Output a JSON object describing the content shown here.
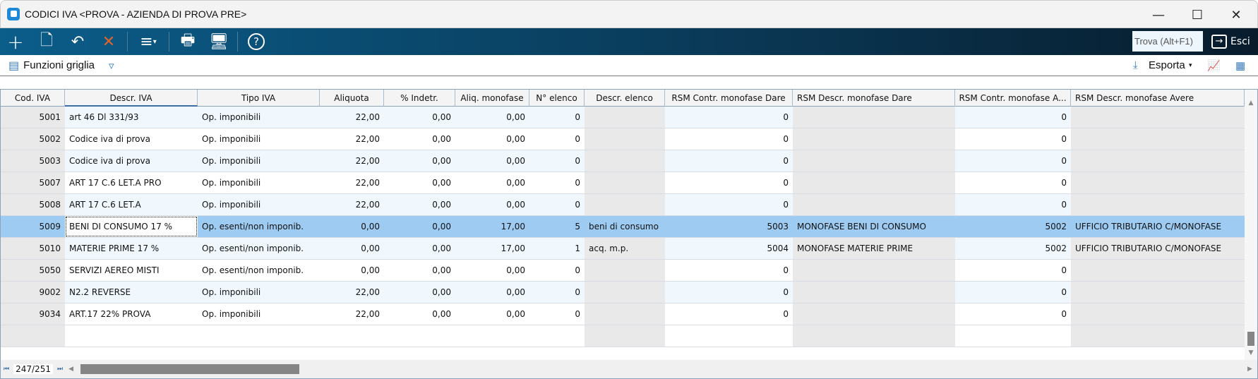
{
  "window": {
    "title": "CODICI IVA <PROVA - AZIENDA DI PROVA PRE>",
    "minimize": "—",
    "maximize": "☐",
    "close": "✕"
  },
  "toolbar": {
    "find_placeholder": "Trova (Alt+F1)",
    "exit_label": "Esci"
  },
  "subbar": {
    "grid_functions": "Funzioni griglia",
    "export": "Esporta"
  },
  "columns": [
    "Cod. IVA",
    "Descr. IVA",
    "Tipo IVA",
    "Aliquota",
    "% Indetr.",
    "Aliq. monofase",
    "N° elenco",
    "Descr. elenco",
    "RSM Contr. monofase Dare",
    "RSM Descr. monofase Dare",
    "RSM Contr. monofase A...",
    "RSM Descr. monofase Avere"
  ],
  "rows": [
    [
      "5001",
      "art 46 Dl 331/93",
      "Op. imponibili",
      "22,00",
      "0,00",
      "0,00",
      "0",
      "",
      "0",
      "",
      "0",
      ""
    ],
    [
      "5002",
      "Codice iva di prova",
      "Op. imponibili",
      "22,00",
      "0,00",
      "0,00",
      "0",
      "",
      "0",
      "",
      "0",
      ""
    ],
    [
      "5003",
      "Codice iva di prova",
      "Op. imponibili",
      "22,00",
      "0,00",
      "0,00",
      "0",
      "",
      "0",
      "",
      "0",
      ""
    ],
    [
      "5007",
      "ART 17 C.6 LET.A PRO",
      "Op. imponibili",
      "22,00",
      "0,00",
      "0,00",
      "0",
      "",
      "0",
      "",
      "0",
      ""
    ],
    [
      "5008",
      "ART 17 C.6 LET.A",
      "Op. imponibili",
      "22,00",
      "0,00",
      "0,00",
      "0",
      "",
      "0",
      "",
      "0",
      ""
    ],
    [
      "5009",
      "BENI DI CONSUMO 17 %",
      "Op. esenti/non imponib.",
      "0,00",
      "0,00",
      "17,00",
      "5",
      "beni di consumo",
      "5003",
      "MONOFASE BENI DI CONSUMO",
      "5002",
      "UFFICIO TRIBUTARIO C/MONOFASE"
    ],
    [
      "5010",
      "MATERIE PRIME 17 %",
      "Op. esenti/non imponib.",
      "0,00",
      "0,00",
      "17,00",
      "1",
      "acq. m.p.",
      "5004",
      "MONOFASE MATERIE PRIME",
      "5002",
      "UFFICIO TRIBUTARIO C/MONOFASE"
    ],
    [
      "5050",
      "SERVIZI AEREO MISTI",
      "Op. esenti/non imponib.",
      "0,00",
      "0,00",
      "0,00",
      "0",
      "",
      "0",
      "",
      "0",
      ""
    ],
    [
      "9002",
      "N2.2 REVERSE",
      "Op. imponibili",
      "22,00",
      "0,00",
      "0,00",
      "0",
      "",
      "0",
      "",
      "0",
      ""
    ],
    [
      "9034",
      "ART.17 22% PROVA",
      "Op. imponibili",
      "22,00",
      "0,00",
      "0,00",
      "0",
      "",
      "0",
      "",
      "0",
      ""
    ]
  ],
  "selected_row": 5,
  "footer": {
    "record_position": "247/251"
  }
}
